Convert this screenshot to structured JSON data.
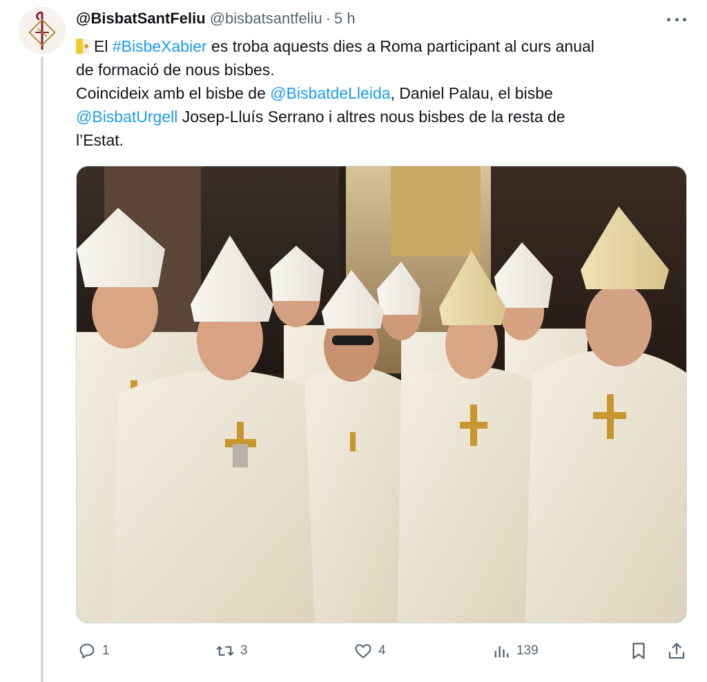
{
  "tweet": {
    "display_name": "@BisbatSantFeliu",
    "handle": "@bisbatsantfeliu",
    "separator": "·",
    "time": "5 h",
    "text": {
      "l1_a": "El ",
      "l1_link": "#BisbeXabier",
      "l1_b": " es troba aquests dies a Roma participant al curs anual",
      "l2": "de formació de nous bisbes.",
      "l3_a": "Coincideix amb el bisbe de ",
      "l3_link": "@BisbatdeLleida",
      "l3_b": ", Daniel Palau, el bisbe",
      "l4_link": "@BisbatUrgell",
      "l4_b": " Josep-Lluís Serrano i altres nous bisbes de la resta de",
      "l5": "l’Estat."
    }
  },
  "actions": {
    "reply_count": "1",
    "retweet_count": "3",
    "like_count": "4",
    "views_count": "139"
  },
  "icons": {
    "reply": "reply-icon",
    "retweet": "retweet-icon",
    "like": "heart-icon",
    "views": "views-icon",
    "bookmark": "bookmark-icon",
    "share": "share-icon",
    "more": "more-icon",
    "flag": "vatican-flag-icon"
  },
  "colors": {
    "link": "#1d9bf0",
    "muted": "#536471",
    "text": "#0f1419",
    "thread_line": "#cfd9de"
  }
}
